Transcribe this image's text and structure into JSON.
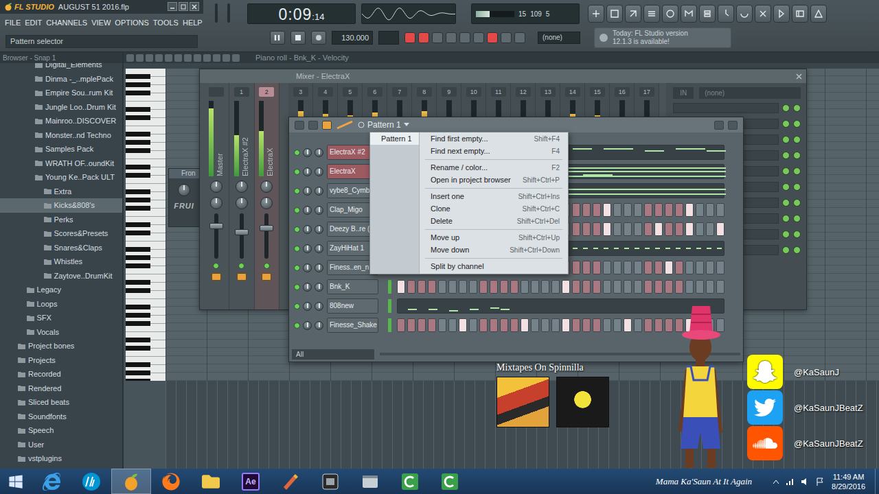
{
  "window": {
    "app": "FL STUDIO",
    "title": "AUGUST 51 2016.flp"
  },
  "menu": [
    "FILE",
    "EDIT",
    "CHANNELS",
    "VIEW",
    "OPTIONS",
    "TOOLS",
    "HELP"
  ],
  "hint": "Pattern selector",
  "transport": {
    "time": "0:09",
    "fraction": ":14",
    "tempo": "130.000",
    "pattern": "(none)",
    "playing": true,
    "recording": false
  },
  "cpu": {
    "readings": [
      "15",
      "109",
      "5"
    ],
    "level": 0.35
  },
  "news": [
    "Today: FL Studio version",
    "12.1.3 is available!"
  ],
  "browser": {
    "title": "Browser - Snap 1",
    "items": [
      {
        "label": "Digital_Elements",
        "depth": 2,
        "selected": false
      },
      {
        "label": "Dinma -_..mplePack",
        "depth": 2,
        "selected": false
      },
      {
        "label": "Empire Sou..rum Kit",
        "depth": 2,
        "selected": false
      },
      {
        "label": "Jungle Loo..Drum Kit",
        "depth": 2,
        "selected": false
      },
      {
        "label": "Mainroo..DISCOVER",
        "depth": 2,
        "selected": false
      },
      {
        "label": "Monster..nd Techno",
        "depth": 2,
        "selected": false
      },
      {
        "label": "Samples Pack",
        "depth": 2,
        "selected": false
      },
      {
        "label": "WRATH OF..oundKit",
        "depth": 2,
        "selected": false
      },
      {
        "label": "Young Ke..Pack ULT",
        "depth": 2,
        "selected": false
      },
      {
        "label": "Extra",
        "depth": 3,
        "selected": false
      },
      {
        "label": "Kicks&808's",
        "depth": 3,
        "selected": true
      },
      {
        "label": "Perks",
        "depth": 3,
        "selected": false
      },
      {
        "label": "Scores&Presets",
        "depth": 3,
        "selected": false
      },
      {
        "label": "Snares&Claps",
        "depth": 3,
        "selected": false
      },
      {
        "label": "Whistles",
        "depth": 3,
        "selected": false
      },
      {
        "label": "Zaytove..DrumKit",
        "depth": 3,
        "selected": false
      },
      {
        "label": "Legacy",
        "depth": 1,
        "selected": false
      },
      {
        "label": "Loops",
        "depth": 1,
        "selected": false
      },
      {
        "label": "SFX",
        "depth": 1,
        "selected": false
      },
      {
        "label": "Vocals",
        "depth": 1,
        "selected": false
      },
      {
        "label": "Project bones",
        "depth": 0,
        "selected": false
      },
      {
        "label": "Projects",
        "depth": 0,
        "selected": false
      },
      {
        "label": "Recorded",
        "depth": 0,
        "selected": false
      },
      {
        "label": "Rendered",
        "depth": 0,
        "selected": false
      },
      {
        "label": "Sliced beats",
        "depth": 0,
        "selected": false
      },
      {
        "label": "Soundfonts",
        "depth": 0,
        "selected": false
      },
      {
        "label": "Speech",
        "depth": 0,
        "selected": false
      },
      {
        "label": "User",
        "depth": 0,
        "selected": false
      },
      {
        "label": "vstplugins",
        "depth": 0,
        "selected": false
      }
    ]
  },
  "pianoRoll": {
    "title": "Piano roll - Bnk_K - Velocity"
  },
  "plugin": {
    "title": "Fron",
    "brand": "FRUI"
  },
  "mixer": {
    "title": "Mixer - ElectraX",
    "input": "IN",
    "route": "(none)",
    "strips": [
      {
        "label": "Master",
        "level": 0.9,
        "fader": 0.75,
        "selected": false
      },
      {
        "label": "ElectraX #2",
        "number": "1",
        "level": 0.55,
        "fader": 0.6,
        "selected": false
      },
      {
        "label": "ElectraX",
        "number": "2",
        "level": 0.6,
        "fader": 0.7,
        "selected": true
      }
    ],
    "inserts": [
      {
        "number": "3",
        "level": 0.6
      },
      {
        "number": "4",
        "level": 0.5
      },
      {
        "number": "5",
        "level": 0.45
      },
      {
        "number": "6",
        "level": 0.55
      },
      {
        "number": "7",
        "level": 0.35
      },
      {
        "number": "8",
        "level": 0.6
      },
      {
        "number": "9",
        "level": 0.4
      },
      {
        "number": "10",
        "level": 0.3
      },
      {
        "number": "11",
        "level": 0
      },
      {
        "number": "12",
        "level": 0
      },
      {
        "number": "13",
        "level": 0
      },
      {
        "number": "14",
        "level": 0.5
      },
      {
        "number": "15",
        "level": 0.45
      },
      {
        "number": "16",
        "level": 0
      },
      {
        "number": "17",
        "level": 0
      }
    ],
    "slots": [
      {
        "enabled": true
      },
      {
        "enabled": true
      },
      {
        "enabled": true
      },
      {
        "enabled": true
      },
      {
        "enabled": true
      },
      {
        "enabled": true
      },
      {
        "enabled": true
      },
      {
        "enabled": true
      },
      {
        "enabled": true
      },
      {
        "enabled": true
      }
    ]
  },
  "channelRack": {
    "title": "Pattern 1",
    "filter": "All",
    "channels": [
      {
        "name": "ElectraX #2",
        "kind": "roll",
        "selected": true,
        "notes": [
          [
            17,
            2,
            1
          ],
          [
            20,
            3,
            1
          ],
          [
            24,
            2,
            2
          ],
          [
            27,
            3,
            1
          ],
          [
            30,
            2,
            2
          ]
        ]
      },
      {
        "name": "ElectraX",
        "kind": "roll",
        "selected": true,
        "notes": [
          [
            16,
            16,
            1
          ],
          [
            16,
            16,
            3
          ],
          [
            16,
            16,
            6
          ],
          [
            18,
            3,
            5
          ]
        ]
      },
      {
        "name": "vybe8_Cymb",
        "kind": "roll",
        "selected": false,
        "notes": [
          [
            16,
            16,
            2
          ],
          [
            16,
            16,
            5
          ]
        ]
      },
      {
        "name": "Clap_Migo",
        "kind": "steps",
        "selected": false,
        "steps": [
          false,
          false,
          false,
          false,
          false,
          false,
          false,
          false,
          false,
          false,
          false,
          false,
          false,
          false,
          false,
          false,
          false,
          false,
          false,
          false,
          true,
          false,
          false,
          false,
          false,
          false,
          false,
          false,
          true,
          false,
          false,
          false
        ]
      },
      {
        "name": "Deezy B..re (",
        "kind": "steps",
        "selected": false,
        "steps": [
          false,
          false,
          false,
          false,
          false,
          false,
          false,
          false,
          false,
          false,
          false,
          false,
          false,
          false,
          false,
          false,
          false,
          false,
          false,
          false,
          true,
          false,
          false,
          false,
          false,
          true,
          false,
          false,
          true,
          false,
          false,
          true
        ]
      },
      {
        "name": "ZayHiHat 1",
        "kind": "roll",
        "selected": false,
        "notes": [
          [
            16,
            0.6,
            3
          ],
          [
            17,
            0.6,
            3
          ],
          [
            18,
            0.6,
            3
          ],
          [
            19,
            0.6,
            3
          ],
          [
            20,
            0.6,
            3
          ],
          [
            21,
            0.6,
            3
          ],
          [
            22,
            0.6,
            3
          ],
          [
            23,
            0.6,
            3
          ],
          [
            24,
            0.6,
            3
          ],
          [
            25,
            0.6,
            3
          ],
          [
            26,
            0.6,
            3
          ],
          [
            27,
            0.6,
            3
          ],
          [
            28,
            0.6,
            3
          ],
          [
            29,
            0.6,
            3
          ],
          [
            30,
            0.6,
            3
          ],
          [
            31,
            0.6,
            3
          ]
        ]
      },
      {
        "name": "Finess..en_n",
        "kind": "steps",
        "selected": false,
        "steps": [
          false,
          false,
          false,
          false,
          false,
          false,
          false,
          false,
          false,
          false,
          false,
          false,
          false,
          false,
          false,
          false,
          false,
          false,
          false,
          false,
          false,
          false,
          false,
          false,
          false,
          false,
          true,
          false,
          false,
          false,
          false,
          false
        ]
      },
      {
        "name": "Bnk_K",
        "kind": "steps",
        "selected": false,
        "steps": [
          true,
          false,
          false,
          false,
          false,
          false,
          false,
          false,
          false,
          false,
          false,
          false,
          false,
          false,
          false,
          false,
          true,
          false,
          false,
          false,
          false,
          false,
          false,
          false,
          false,
          false,
          false,
          false,
          false,
          false,
          false,
          false
        ]
      },
      {
        "name": "808new",
        "kind": "roll",
        "selected": false,
        "notes": [
          [
            1,
            1,
            5
          ],
          [
            3,
            1,
            5
          ],
          [
            5,
            1,
            6
          ],
          [
            7,
            1,
            5
          ],
          [
            9,
            1,
            4
          ],
          [
            10,
            1,
            5
          ]
        ]
      },
      {
        "name": "Finesse_Shake",
        "kind": "steps",
        "selected": false,
        "steps": [
          false,
          false,
          false,
          false,
          false,
          false,
          true,
          false,
          false,
          false,
          false,
          false,
          true,
          false,
          false,
          false,
          true,
          false,
          false,
          false,
          false,
          false,
          true,
          false,
          false,
          false,
          false,
          false,
          true,
          false,
          false,
          false
        ]
      }
    ]
  },
  "contextMenu": {
    "patterns": [
      {
        "label": "Pattern 1",
        "selected": true
      }
    ],
    "groups": [
      [
        {
          "label": "Find first empty...",
          "shortcut": "Shift+F4"
        },
        {
          "label": "Find next empty...",
          "shortcut": "F4"
        }
      ],
      [
        {
          "label": "Rename / color...",
          "shortcut": "F2"
        },
        {
          "label": "Open in project browser",
          "shortcut": "Shift+Ctrl+P"
        }
      ],
      [
        {
          "label": "Insert one",
          "shortcut": "Shift+Ctrl+Ins"
        },
        {
          "label": "Clone",
          "shortcut": "Shift+Ctrl+C"
        },
        {
          "label": "Delete",
          "shortcut": "Shift+Ctrl+Del"
        }
      ],
      [
        {
          "label": "Move up",
          "shortcut": "Shift+Ctrl+Up"
        },
        {
          "label": "Move down",
          "shortcut": "Shift+Ctrl+Down"
        }
      ],
      [
        {
          "label": "Split by channel"
        }
      ]
    ]
  },
  "overlay": {
    "caption": "Mixtapes On Spinnilla",
    "social": [
      {
        "kind": "snapchat",
        "handle": "@KaSaunJ",
        "color": "#fffc00"
      },
      {
        "kind": "twitter",
        "handle": "@KaSaunJBeatZ",
        "color": "#1da1f2"
      },
      {
        "kind": "soundcloud",
        "handle": "@KaSaunJBeatZ",
        "color": "#ff5500"
      }
    ]
  },
  "taskbar": {
    "caption": "Mama Ka'Saun At It Again",
    "time": "11:49 AM",
    "date": "8/29/2016",
    "apps": [
      {
        "kind": "ie",
        "selected": false
      },
      {
        "kind": "hp",
        "selected": false
      },
      {
        "kind": "fl",
        "selected": true
      },
      {
        "kind": "firefox",
        "selected": false
      },
      {
        "kind": "folder",
        "selected": false
      },
      {
        "kind": "ae",
        "label": "Ae",
        "selected": false
      },
      {
        "kind": "tool",
        "selected": false
      },
      {
        "kind": "media",
        "selected": false
      },
      {
        "kind": "window",
        "selected": false
      },
      {
        "kind": "camtasia",
        "selected": false
      },
      {
        "kind": "camtasia",
        "selected": false
      }
    ]
  }
}
